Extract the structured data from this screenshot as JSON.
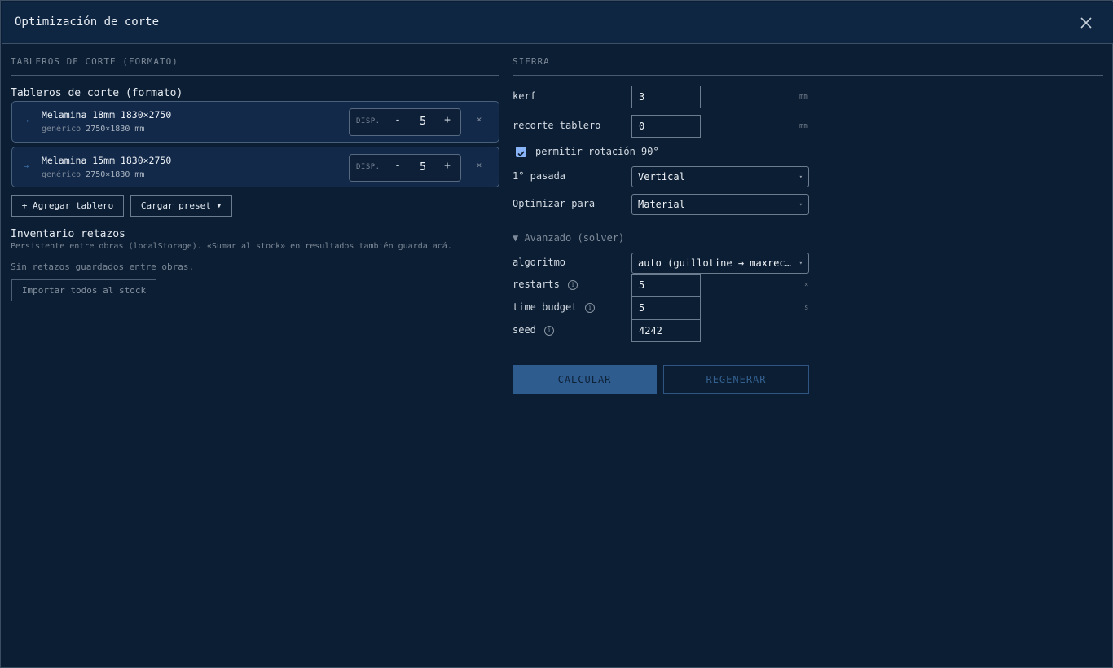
{
  "dialog": {
    "title": "Optimización de corte",
    "close_label": "close"
  },
  "left": {
    "section_title": "TABLEROS DE CORTE (FORMATO)",
    "subsection_title": "Tableros de corte (formato)",
    "boards": [
      {
        "name": "Melamina 18mm 1830×2750",
        "kind": "genérico",
        "dims": "2750×1830 mm",
        "disp_label": "DISP.",
        "qty": "5"
      },
      {
        "name": "Melamina 15mm 1830×2750",
        "kind": "genérico",
        "dims": "2750×1830 mm",
        "disp_label": "DISP.",
        "qty": "5"
      }
    ],
    "minus_label": "-",
    "plus_label": "+",
    "remove_label": "×",
    "arrow_glyph": "→",
    "add_board_label": "+ Agregar tablero",
    "load_preset_label": "Cargar preset ▾",
    "offcuts": {
      "title": "Inventario retazos",
      "description": "Persistente entre obras (localStorage). «Sumar al stock» en resultados también guarda acá.",
      "empty_text": "Sin retazos guardados entre obras.",
      "import_label": "Importar todos al stock"
    }
  },
  "right": {
    "section_title": "SIERRA",
    "kerf": {
      "label": "kerf",
      "value": "3",
      "unit": "mm"
    },
    "trim": {
      "label": "recorte tablero",
      "value": "0",
      "unit": "mm"
    },
    "rotation": {
      "label": "permitir rotación 90°",
      "checked": true
    },
    "first_pass": {
      "label": "1° pasada",
      "value": "Vertical"
    },
    "optimize_for": {
      "label": "Optimizar para",
      "value": "Material"
    },
    "advanced_toggle": "▼ Avanzado (solver)",
    "algorithm": {
      "label": "algoritmo",
      "value": "auto (guillotine → maxrects)"
    },
    "restarts": {
      "label": "restarts",
      "value": "5",
      "unit": "×"
    },
    "time_budget": {
      "label": "time budget",
      "value": "5",
      "unit": "s"
    },
    "seed": {
      "label": "seed",
      "value": "4242"
    },
    "info_glyph": "i",
    "calculate_label": "CALCULAR",
    "regenerate_label": "REGENERAR"
  },
  "colors": {
    "background": "#0c1e33",
    "titlebar": "#0f2642",
    "accent": "#2e5c8f",
    "checkbox": "#8ab4f8"
  }
}
